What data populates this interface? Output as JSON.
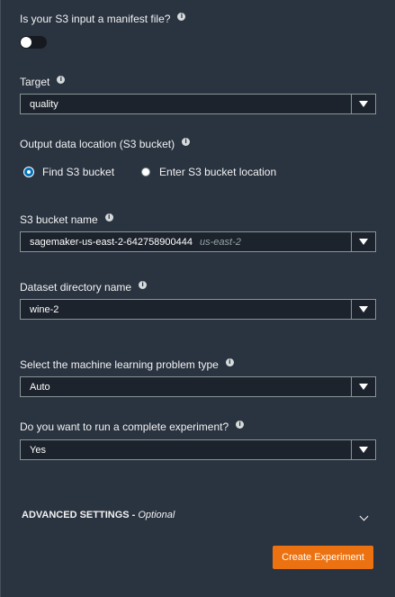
{
  "manifest": {
    "label": "Is your S3 input a manifest file?",
    "enabled": false
  },
  "target": {
    "label": "Target",
    "value": "quality"
  },
  "output": {
    "label": "Output data location (S3 bucket)",
    "options": [
      "Find S3 bucket",
      "Enter S3 bucket location"
    ],
    "selected": "Find S3 bucket"
  },
  "bucket": {
    "label": "S3 bucket name",
    "value": "sagemaker-us-east-2-642758900444",
    "region": "us-east-2"
  },
  "dataset_dir": {
    "label": "Dataset directory name",
    "value": "wine-2"
  },
  "problem_type": {
    "label": "Select the machine learning problem type",
    "value": "Auto"
  },
  "complete": {
    "label": "Do you want to run a complete experiment?",
    "value": "Yes"
  },
  "advanced": {
    "title": "ADVANCED SETTINGS - ",
    "optional": "Optional"
  },
  "create_button": "Create Experiment",
  "info_glyph": "i",
  "colors": {
    "background": "#2a3340",
    "accent": "#ec7211",
    "radio": "#0073bb"
  }
}
